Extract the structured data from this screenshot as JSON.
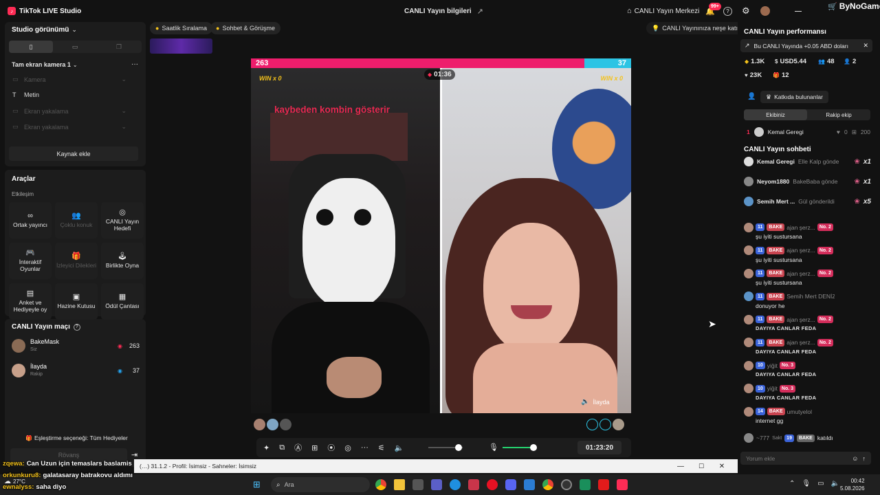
{
  "app": {
    "title": "TikTok LIVE Studio",
    "brand": "ByNoGame"
  },
  "topbar": {
    "center_title": "CANLI Yayın bilgileri",
    "center_link": "CANLI Yayın Merkezi",
    "notif_count": "99+"
  },
  "left": {
    "studio_view": "Studio görünümü",
    "scene": "Tam ekran kamera 1",
    "sources": [
      {
        "label": "Kamera",
        "active": false
      },
      {
        "label": "Metin",
        "active": true
      },
      {
        "label": "Ekran yakalama",
        "active": false
      },
      {
        "label": "Ekran yakalama",
        "active": false
      }
    ],
    "add_source": "Kaynak ekle",
    "tools_title": "Araçlar",
    "engagement": "Etkileşim",
    "tools": [
      {
        "label": "Ortak yayıncı",
        "icon": "link-icon",
        "disabled": false
      },
      {
        "label": "Çoklu konuk",
        "icon": "group-icon",
        "disabled": true
      },
      {
        "label": "CANLI Yayın Hedefi",
        "icon": "target-icon",
        "disabled": false
      },
      {
        "label": "İnteraktif Oyunlar",
        "icon": "gamepad-icon",
        "disabled": false
      },
      {
        "label": "İzleyici Dilekleri",
        "icon": "gift-icon",
        "disabled": true
      },
      {
        "label": "Birlikte Oyna",
        "icon": "joystick-icon",
        "disabled": false
      },
      {
        "label": "Anket ve Hediyeyle oy",
        "icon": "poll-icon",
        "disabled": false
      },
      {
        "label": "Hazine Kutusu",
        "icon": "chest-icon",
        "disabled": false
      },
      {
        "label": "Ödül Çantası",
        "icon": "bag-icon",
        "disabled": false
      }
    ],
    "match_title": "CANLI Yayın maçı",
    "match_players": [
      {
        "name": "BakeMask",
        "role": "Siz",
        "score": "263",
        "color": "#fe2c55"
      },
      {
        "name": "İlayda",
        "role": "Rakip",
        "score": "37",
        "color": "#25a7f5"
      }
    ],
    "matching_option": "Eşleştirme seçeneği: Tüm Hediyeler",
    "rematch": "Rövanş"
  },
  "top_chips": {
    "rank": "Saatlik Sıralama",
    "chat": "Sohbet & Görüşme",
    "fun": "CANLI Yayınınıza neşe katın"
  },
  "preview": {
    "score_left": "263",
    "score_right": "37",
    "win_left": "WIN x 0",
    "win_right": "WIN x 0",
    "timer": "01:36",
    "overlay_text": "kaybeden kombin gösterir",
    "right_name": "İlayda",
    "live_time": "01:23:20"
  },
  "right": {
    "perf_title": "CANLI Yayın performansı",
    "earn_banner": "Bu CANLI Yayında +0.05 ABD doları",
    "stats": [
      {
        "icon": "diamond-icon",
        "value": "1.3K"
      },
      {
        "icon": "dollar-icon",
        "value": "USD5.44"
      },
      {
        "icon": "users-icon",
        "value": "48"
      },
      {
        "icon": "person-icon",
        "value": "2"
      },
      {
        "icon": "heart-icon",
        "value": "23K"
      },
      {
        "icon": "gift-icon",
        "value": "12"
      }
    ],
    "contributors_btn": "Katkıda bulunanlar",
    "team_tabs": [
      "Ekibiniz",
      "Rakip ekip"
    ],
    "top_contributor": {
      "rank": "1",
      "name": "Kemal Geregi",
      "likes": "0",
      "gifts": "200"
    },
    "chat_title": "CANLI Yayın sohbeti",
    "gift_rows": [
      {
        "name": "Kemal Geregi",
        "text": "Elle Kalp gönde",
        "count": "x1"
      },
      {
        "name": "Neyom1880",
        "text": "BakeBaba gönde",
        "count": "x1"
      },
      {
        "name": "Semih Mert ...",
        "text": "Gül gönderildi",
        "count": "x5"
      }
    ],
    "chat_rows": [
      {
        "lvl": "11",
        "fan": "BAKE",
        "user": "ajan şerz...",
        "no": "No. 2",
        "msg": "şu iyiti sustursana",
        "caps": false
      },
      {
        "lvl": "11",
        "fan": "BAKE",
        "user": "ajan şerz...",
        "no": "No. 2",
        "msg": "şu iyiti sustursana",
        "caps": false
      },
      {
        "lvl": "11",
        "fan": "BAKE",
        "user": "ajan şerz...",
        "no": "No. 2",
        "msg": "şu iyiti sustursana",
        "caps": false
      },
      {
        "lvl": "11",
        "fan": "BAKE",
        "user": "Semih Mert DENİZ",
        "no": "",
        "msg": "donuyor he",
        "caps": false
      },
      {
        "lvl": "11",
        "fan": "BAKE",
        "user": "ajan şerz...",
        "no": "No. 2",
        "msg": "DAYIYA CANLAR FEDA",
        "caps": true
      },
      {
        "lvl": "11",
        "fan": "BAKE",
        "user": "ajan şerz...",
        "no": "No. 2",
        "msg": "DAYIYA CANLAR FEDA",
        "caps": true
      },
      {
        "lvl": "10",
        "fan": "",
        "user": "yiğit",
        "no": "No. 3",
        "msg": "DAYIYA CANLAR FEDA",
        "caps": true
      },
      {
        "lvl": "10",
        "fan": "",
        "user": "yiğit",
        "no": "No. 3",
        "msg": "DAYIYA CANLAR FEDA",
        "caps": true
      },
      {
        "lvl": "14",
        "fan": "BAKE",
        "user": "umutyelol",
        "no": "",
        "msg": "internet gg",
        "caps": false
      }
    ],
    "join_row": {
      "user": "~777",
      "extra": "Sakt",
      "lvl": "19",
      "fan": "BAKE",
      "text": "katıldı"
    },
    "comment_placeholder": "Yorum ekle"
  },
  "obs_bar": {
    "title": "(…) 31.1.2 - Profil: İsimsiz - Sahneler: İsimsiz"
  },
  "stream_chat": [
    {
      "user": "zqewa:",
      "msg": "Can Uzun için temaslars baslamis"
    },
    {
      "user": "orkunkuru8:",
      "msg": "galatasaray batrakovu aldımı"
    },
    {
      "user": "ewnalyss:",
      "msg": "saha diyo"
    }
  ],
  "taskbar": {
    "weather": "27°C",
    "search": "Ara",
    "time": "00:42",
    "date": "5.08.2026"
  }
}
